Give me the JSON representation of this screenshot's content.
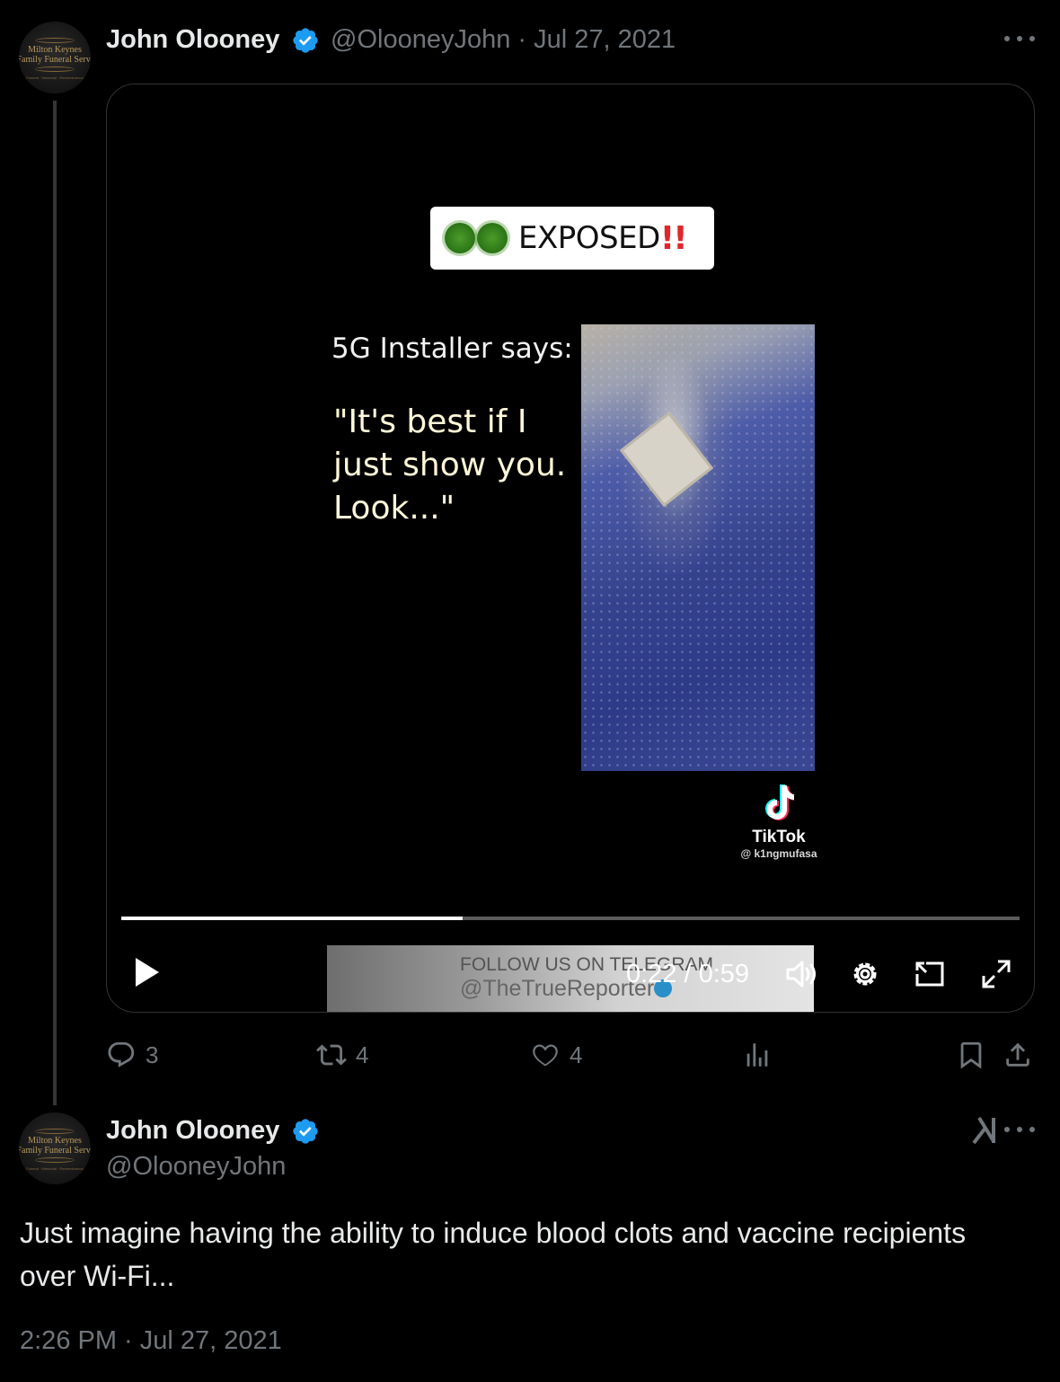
{
  "tweet1": {
    "avatar": {
      "line1": "Milton Keynes",
      "line2": "Family Funeral Servi",
      "line3": "Funeral · Memorial · Remembrance"
    },
    "author_name": "John Olooney",
    "handle_date": "@OlooneyJohn · Jul 27, 2021",
    "video": {
      "badge_text": "EXPOSED",
      "badge_exclaim": "!!",
      "installer_text": "5G Installer says:",
      "quote_text": "\"It's best if I just show you. Look...\"",
      "tiktok_label": "TikTok",
      "tiktok_user": "@ k1ngmufasa",
      "watermark_line1": "FOLLOW US ON TELEGRAM",
      "watermark_line2": "@TheTrueReporter",
      "time_display": "0:22 / 0:59",
      "progress": 0.38
    },
    "actions": {
      "replies": "3",
      "reposts": "4",
      "likes": "4"
    }
  },
  "tweet2": {
    "avatar": {
      "line1": "Milton Keynes",
      "line2": "Family Funeral Servi",
      "line3": "Funeral · Memorial · Remembrance"
    },
    "author_name": "John Olooney",
    "handle": "@OlooneyJohn",
    "text": "Just imagine having the ability to induce blood clots and vaccine recipients over Wi-Fi...",
    "timestamp": "2:26 PM · Jul 27, 2021"
  },
  "colors": {
    "background": "#000000",
    "verified": "#1d9bf0",
    "muted": "#71767b",
    "text": "#e7e9ea"
  },
  "icons": [
    "verified-badge-icon",
    "more-icon",
    "play-icon",
    "volume-icon",
    "settings-icon",
    "pip-icon",
    "fullscreen-icon",
    "reply-icon",
    "repost-icon",
    "like-icon",
    "views-icon",
    "bookmark-icon",
    "share-icon",
    "grok-icon"
  ]
}
